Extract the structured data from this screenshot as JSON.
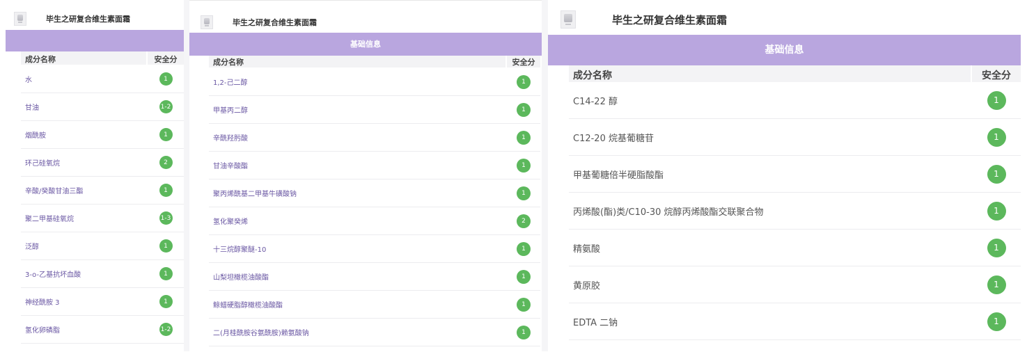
{
  "panels": [
    {
      "title": "毕生之研复合维生素面霜",
      "banner": "",
      "col_name": "成分名称",
      "col_safety": "安全分",
      "rows": [
        {
          "name": "水",
          "score": "1"
        },
        {
          "name": "甘油",
          "score": "1-2"
        },
        {
          "name": "烟酰胺",
          "score": "1"
        },
        {
          "name": "环己硅氧烷",
          "score": "2"
        },
        {
          "name": "辛酸/癸酸甘油三酯",
          "score": "1"
        },
        {
          "name": "聚二甲基硅氧烷",
          "score": "1-3"
        },
        {
          "name": "泛醇",
          "score": "1"
        },
        {
          "name": "3-o-乙基抗坏血酸",
          "score": "1"
        },
        {
          "name": "神经酰胺 3",
          "score": "1"
        },
        {
          "name": "氢化卵磷脂",
          "score": "1-2"
        }
      ]
    },
    {
      "title": "毕生之研复合维生素面霜",
      "banner": "基础信息",
      "col_name": "成分名称",
      "col_safety": "安全分",
      "rows": [
        {
          "name": "1,2-己二醇",
          "score": "1"
        },
        {
          "name": "甲基丙二醇",
          "score": "1"
        },
        {
          "name": "辛酰羟肟酸",
          "score": "1"
        },
        {
          "name": "甘油辛酸酯",
          "score": "1"
        },
        {
          "name": "聚丙烯酰基二甲基牛磺酸钠",
          "score": "1"
        },
        {
          "name": "氢化聚癸烯",
          "score": "2"
        },
        {
          "name": "十三烷醇聚醚-10",
          "score": "1"
        },
        {
          "name": "山梨坦橄榄油酸酯",
          "score": "1"
        },
        {
          "name": "鲸蜡硬脂醇橄榄油酸酯",
          "score": "1"
        },
        {
          "name": "二(月桂酰胺谷氨酰胺)赖氨酸钠",
          "score": "1"
        }
      ]
    },
    {
      "title": "毕生之研复合维生素面霜",
      "banner": "基础信息",
      "col_name": "成分名称",
      "col_safety": "安全分",
      "rows": [
        {
          "name": "C14-22 醇",
          "score": "1"
        },
        {
          "name": "C12-20 烷基葡糖苷",
          "score": "1"
        },
        {
          "name": "甲基葡糖倍半硬脂酸酯",
          "score": "1"
        },
        {
          "name": "丙烯酸(酯)类/C10-30 烷醇丙烯酸酯交联聚合物",
          "score": "1"
        },
        {
          "name": "精氨酸",
          "score": "1"
        },
        {
          "name": "黄原胶",
          "score": "1"
        },
        {
          "name": "EDTA 二钠",
          "score": "1"
        }
      ]
    }
  ],
  "colors": {
    "banner": "#b9a6df",
    "badge": "#5cb85c",
    "header_bg": "#f3f3f5"
  },
  "icons": [
    "product-thumbnail"
  ]
}
